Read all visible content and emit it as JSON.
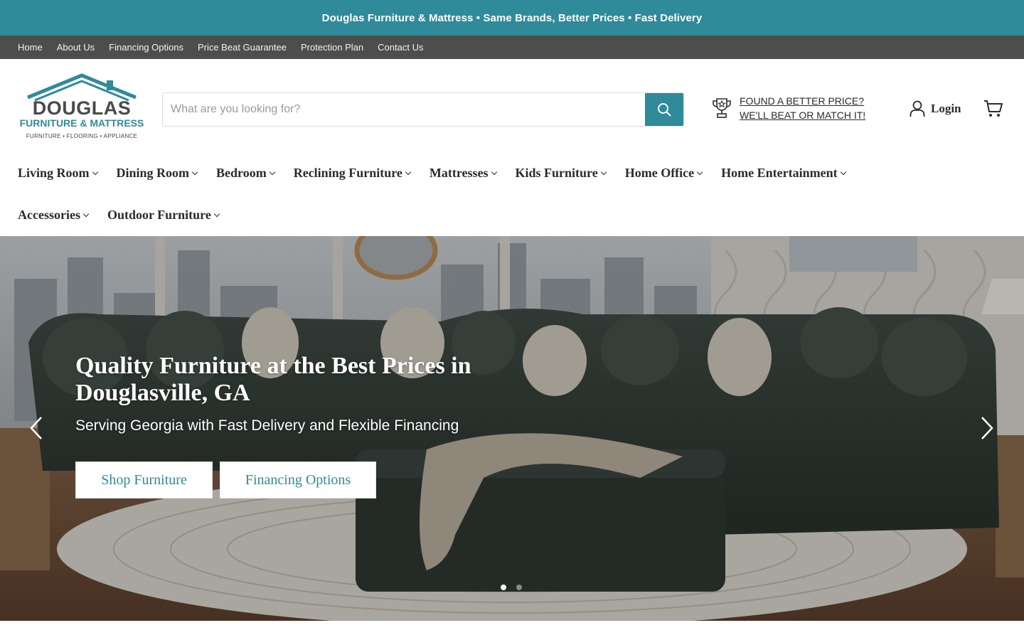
{
  "announcement": "Douglas Furniture & Mattress • Same Brands, Better Prices • Fast Delivery",
  "utility_nav": [
    "Home",
    "About Us",
    "Financing Options",
    "Price Beat Guarantee",
    "Protection Plan",
    "Contact Us"
  ],
  "logo": {
    "name": "DOUGLAS",
    "subtitle": "FURNITURE & MATTRESS",
    "tagline": "FURNITURE • FLOORING • APPLIANCE"
  },
  "search": {
    "placeholder": "What are you looking for?",
    "value": ""
  },
  "price_beat": {
    "line1": "FOUND A BETTER PRICE?",
    "line2": "WE'LL BEAT OR MATCH IT!"
  },
  "account": {
    "login_label": "Login"
  },
  "nav": {
    "row1": [
      "Living Room",
      "Dining Room",
      "Bedroom",
      "Reclining Furniture",
      "Mattresses",
      "Kids Furniture",
      "Home Office",
      "Home Entertainment"
    ],
    "row2": [
      "Accessories",
      "Outdoor Furniture"
    ]
  },
  "hero": {
    "title": "Quality Furniture at the Best Prices in Douglasville, GA",
    "subtitle": "Serving Georgia with Fast Delivery and Flexible Financing",
    "buttons": [
      "Shop Furniture",
      "Financing Options"
    ],
    "slide_count": 2,
    "active_slide": 1
  },
  "colors": {
    "brand_teal": "#2f8a9a",
    "utility_bar": "#4d4d4d",
    "text_dark": "#2b2b2b"
  },
  "icons": {
    "search": "search-icon",
    "trophy": "trophy-icon",
    "user": "user-icon",
    "cart": "cart-icon",
    "prev": "chevron-left-icon",
    "next": "chevron-right-icon"
  }
}
